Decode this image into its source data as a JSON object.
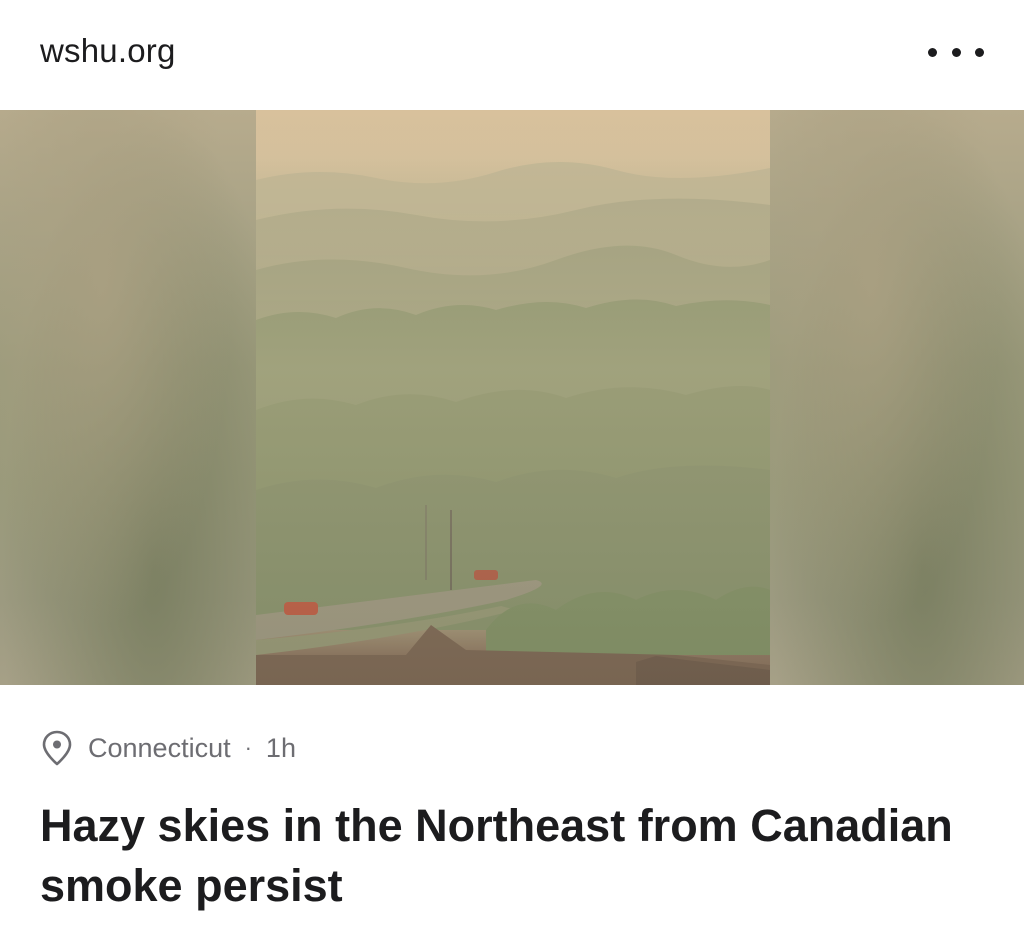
{
  "header": {
    "source": "wshu.org",
    "more_icon": "ellipsis-horizontal-icon"
  },
  "media": {
    "alt": "Smoky hazy view over a wooded hillside with a road and red cars"
  },
  "meta": {
    "location_icon": "location-pin-icon",
    "location": "Connecticut",
    "separator": "·",
    "time": "1h"
  },
  "article": {
    "headline": "Hazy skies in the Northeast from Canadian smoke persist"
  },
  "colors": {
    "text_primary": "#1c1c1e",
    "text_secondary": "#6d6d72",
    "background": "#ffffff"
  }
}
